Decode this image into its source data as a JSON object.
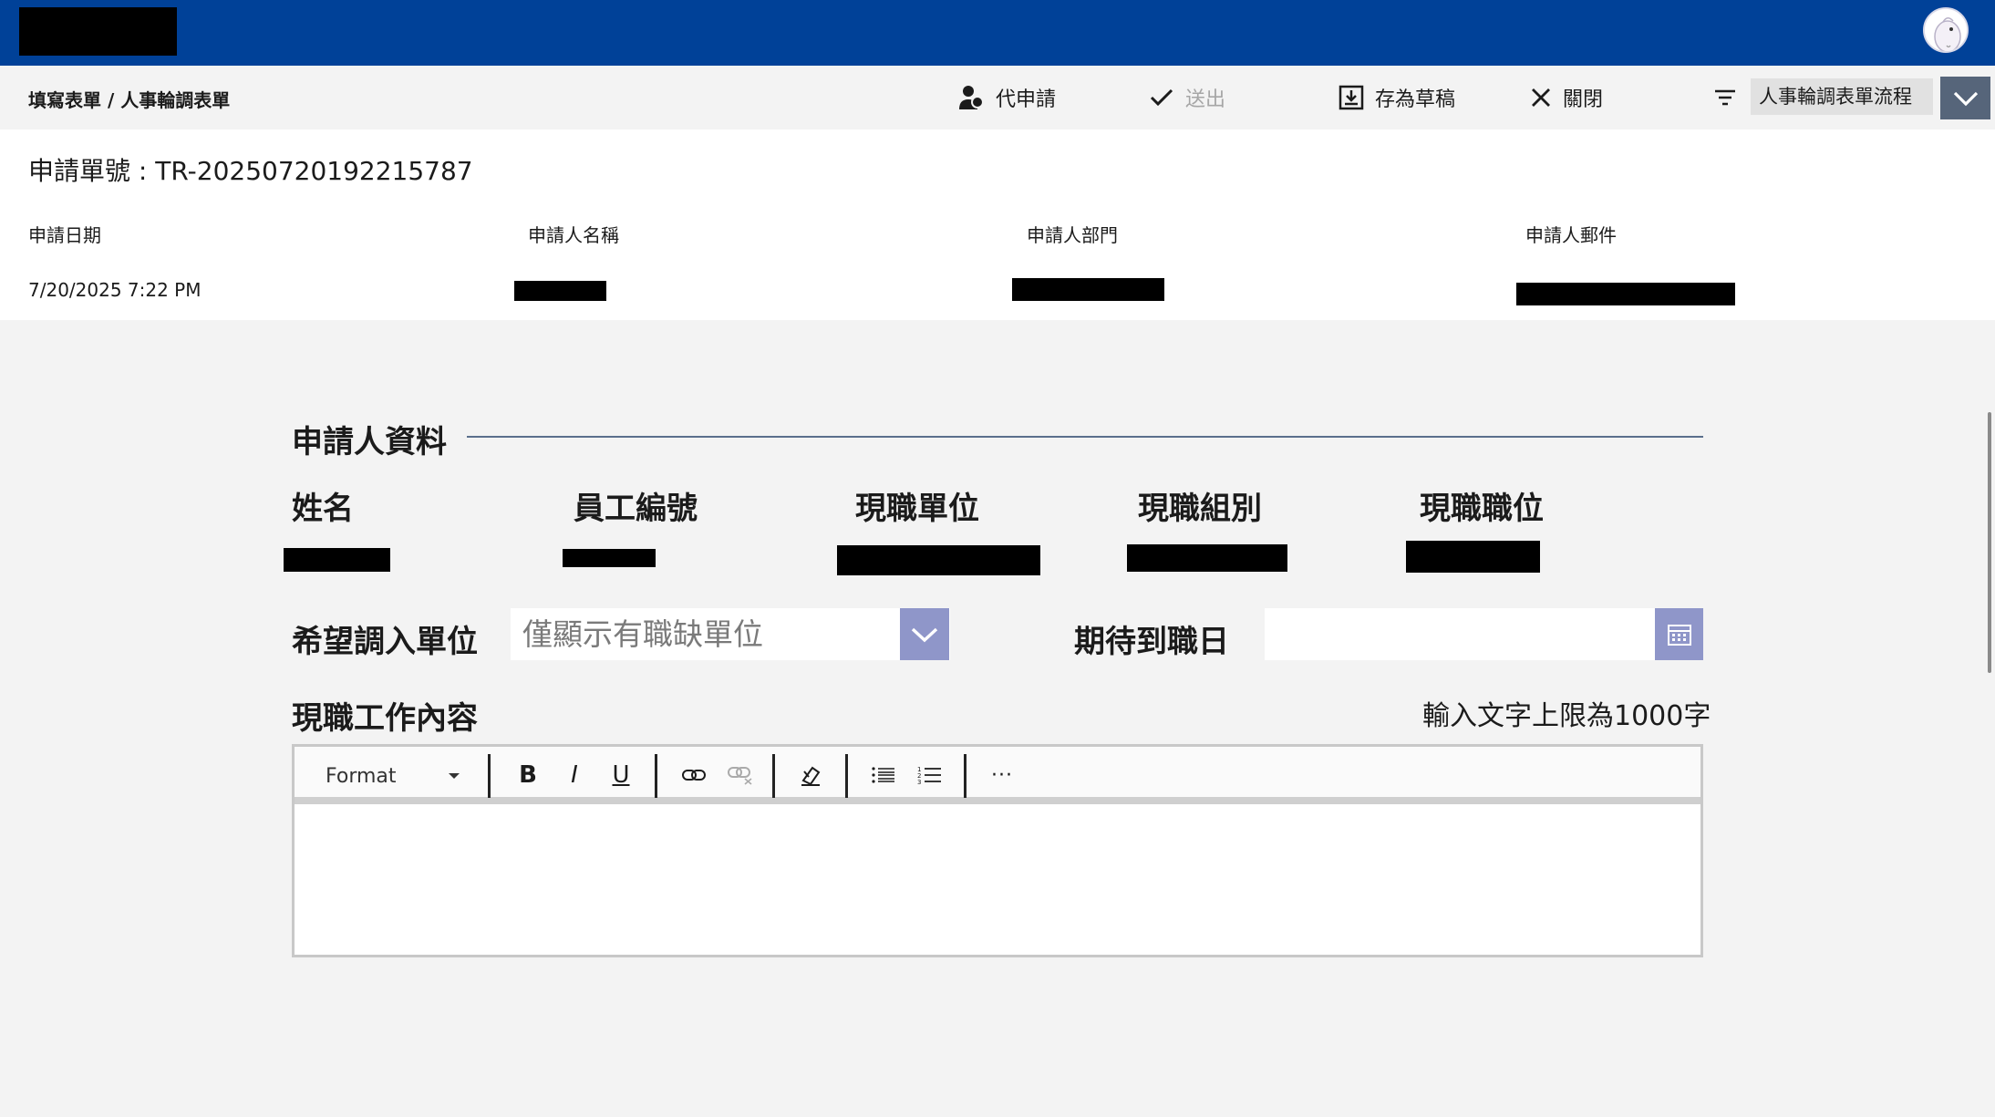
{
  "header": {
    "avatar_alt": "user-avatar"
  },
  "commandbar": {
    "breadcrumb": "填寫表單 / 人事輪調表單",
    "delegate_label": "代申請",
    "submit_label": "送出",
    "draft_label": "存為草稿",
    "close_label": "關閉",
    "flow_select_value": "人事輪調表單流程"
  },
  "info": {
    "application_no": "申請單號 : TR-20250720192215787",
    "labels": {
      "date": "申請日期",
      "name": "申請人名稱",
      "dept": "申請人部門",
      "email": "申請人郵件"
    },
    "values": {
      "date": "7/20/2025 7:22 PM"
    }
  },
  "form": {
    "section_title": "申請人資料",
    "columns": {
      "name": "姓名",
      "emp_no": "員工編號",
      "unit": "現職單位",
      "group": "現職組別",
      "position": "現職職位"
    },
    "desired_unit_label": "希望調入單位",
    "desired_unit_placeholder": "僅顯示有職缺單位",
    "expected_date_label": "期待到職日",
    "job_content_label": "現職工作內容",
    "char_limit_text": "輸入文字上限為1000字"
  },
  "editor_toolbar": {
    "format_label": "Format",
    "bold": "B",
    "italic": "I",
    "underline": "U",
    "more": "···"
  },
  "colors": {
    "topbar": "#004198",
    "accent_button": "#8f96c9",
    "flow_caret": "#56657a"
  }
}
